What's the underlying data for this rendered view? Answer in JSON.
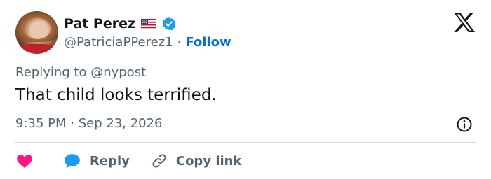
{
  "author": {
    "name": "Pat Perez",
    "handle": "@PatriciaPPerez1",
    "separator": "·",
    "follow_label": "Follow"
  },
  "icons": {
    "flag": "us-flag-icon",
    "verified": "verified-badge-icon",
    "logo": "x-logo-icon",
    "info": "info-icon",
    "like": "heart-icon",
    "reply": "speech-bubble-icon",
    "copy": "link-icon"
  },
  "tweet": {
    "replying_to": "Replying to @nypost",
    "text": "That child looks terrified.",
    "timestamp": "9:35 PM · Sep 23, 2026"
  },
  "actions": {
    "reply_label": "Reply",
    "copy_label": "Copy link"
  },
  "colors": {
    "text": "#0f1419",
    "secondary": "#536471",
    "follow": "#006fd6",
    "verified": "#1d9bf0",
    "like": "#f91880",
    "reply": "#1d9bf0",
    "divider": "#cfd9de"
  }
}
